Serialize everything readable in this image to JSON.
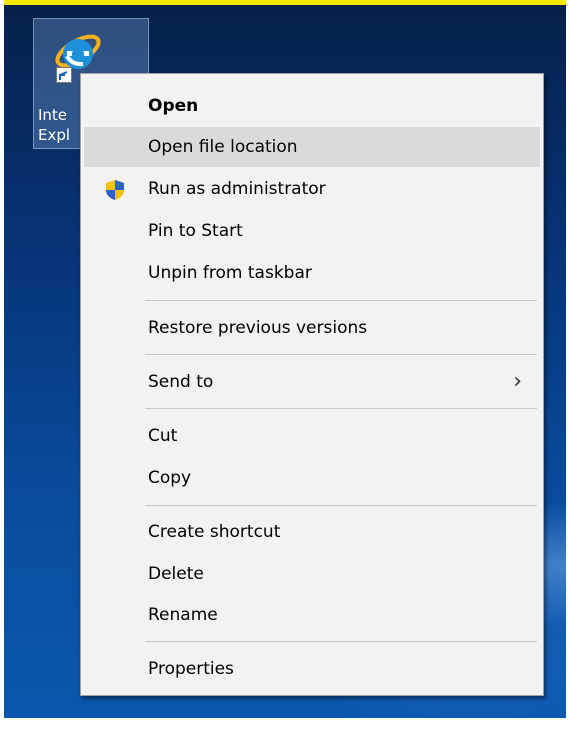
{
  "desktop": {
    "icon": {
      "name": "ie-icon",
      "label_line1": "Inte",
      "label_line2": "Expl"
    }
  },
  "menu": {
    "items": [
      {
        "label": "Open",
        "bold": true
      },
      {
        "label": "Open file location",
        "highlighted": true
      },
      {
        "label": "Run as administrator",
        "icon": "shield-icon"
      },
      {
        "label": "Pin to Start"
      },
      {
        "label": "Unpin from taskbar"
      },
      {
        "label": "Restore previous versions"
      },
      {
        "label": "Send to",
        "has_submenu": true,
        "submenu_glyph": "›"
      },
      {
        "label": "Cut"
      },
      {
        "label": "Copy"
      },
      {
        "label": "Create shortcut"
      },
      {
        "label": "Delete"
      },
      {
        "label": "Rename"
      },
      {
        "label": "Properties"
      }
    ]
  },
  "colors": {
    "highlight": "#dadada",
    "menu_bg": "#f2f2f2",
    "frame_top": "#f5e800"
  }
}
